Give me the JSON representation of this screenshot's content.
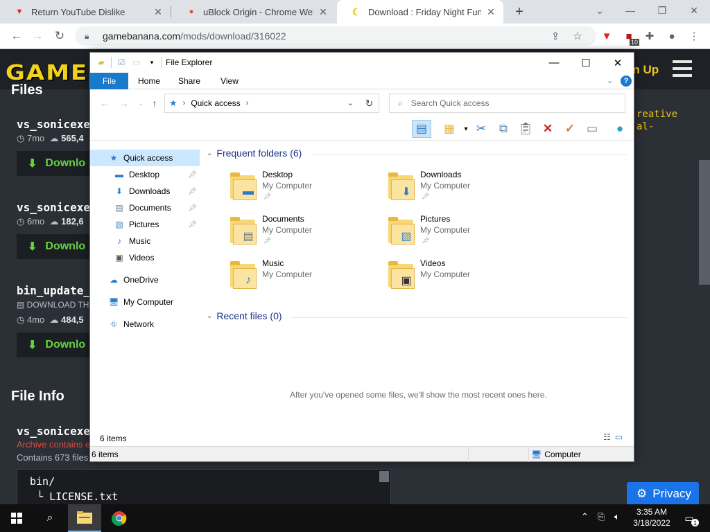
{
  "browser": {
    "tabs": [
      {
        "title": "Return YouTube Dislike",
        "icon": "youtube-dislike-icon"
      },
      {
        "title": "uBlock Origin - Chrome Web Sto",
        "icon": "chrome-web-store-icon"
      },
      {
        "title": "Download : Friday Night Funkin'",
        "icon": "banana-icon"
      }
    ],
    "new_tab": "+",
    "url_host": "gamebanana.com",
    "url_path": "/mods/download/316022",
    "extension_badge": "10"
  },
  "page": {
    "logo": "GAME",
    "signup": "gn Up",
    "files_heading": "Files",
    "files": [
      {
        "name": "vs_sonicexe",
        "age": "7mo",
        "downloads": "565,4"
      },
      {
        "name": "vs_sonicexe",
        "age": "6mo",
        "downloads": "182,6"
      },
      {
        "name": "bin_update_",
        "note": "DOWNLOAD TH",
        "age": "4mo",
        "downloads": "484,5"
      }
    ],
    "download_label": "Downlo",
    "file_info_heading": "File Info",
    "file_info_name": "vs_sonicexe",
    "archive_warning": "Archive contains e",
    "contains": "Contains 673 files",
    "code_line1": "bin/",
    "code_line2": "LICENSE.txt",
    "side_text1": "reative",
    "side_text2": "al-",
    "privacy_label": "Privacy"
  },
  "explorer": {
    "title": "File Explorer",
    "ribbon_tabs": [
      "File",
      "Home",
      "Share",
      "View"
    ],
    "address": "Quick access",
    "search_placeholder": "Search Quick access",
    "nav": [
      {
        "label": "Quick access",
        "icon": "quick-access-star-icon",
        "pinned": false
      },
      {
        "label": "Desktop",
        "icon": "desktop-icon",
        "pinned": true
      },
      {
        "label": "Downloads",
        "icon": "downloads-icon",
        "pinned": true
      },
      {
        "label": "Documents",
        "icon": "documents-icon",
        "pinned": true
      },
      {
        "label": "Pictures",
        "icon": "pictures-icon",
        "pinned": true
      },
      {
        "label": "Music",
        "icon": "music-icon",
        "pinned": false
      },
      {
        "label": "Videos",
        "icon": "videos-icon",
        "pinned": false
      },
      {
        "label": "OneDrive",
        "icon": "onedrive-icon",
        "pinned": false
      },
      {
        "label": "My Computer",
        "icon": "computer-icon",
        "pinned": false
      },
      {
        "label": "Network",
        "icon": "network-icon",
        "pinned": false
      }
    ],
    "frequent_heading": "Frequent folders (6)",
    "folders": [
      {
        "name": "Desktop",
        "location": "My Computer",
        "pinned": true
      },
      {
        "name": "Downloads",
        "location": "My Computer",
        "pinned": true
      },
      {
        "name": "Documents",
        "location": "My Computer",
        "pinned": true
      },
      {
        "name": "Pictures",
        "location": "My Computer",
        "pinned": true
      },
      {
        "name": "Music",
        "location": "My Computer",
        "pinned": false
      },
      {
        "name": "Videos",
        "location": "My Computer",
        "pinned": false
      }
    ],
    "recent_heading": "Recent files (0)",
    "recent_empty": "After you've opened some files, we'll show the most recent ones here.",
    "status_items": "6 items",
    "bottom_items": "6 items",
    "bottom_location": "Computer"
  },
  "taskbar": {
    "time": "3:35 AM",
    "date": "3/18/2022",
    "notification_count": "1"
  },
  "colors": {
    "ribbon_file": "#1979ca",
    "group_heading": "#1e3287",
    "folder_yellow": "#f8d775",
    "download_green": "#66d340",
    "logo_yellow": "#f2d21b",
    "privacy_blue": "#1a73e8"
  }
}
